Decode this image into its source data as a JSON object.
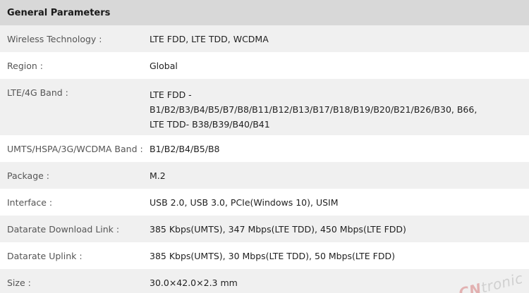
{
  "section_title": "General Parameters",
  "rows": [
    {
      "label": "Wireless Technology :",
      "value": [
        "LTE FDD, LTE TDD, WCDMA"
      ]
    },
    {
      "label": "Region :",
      "value": [
        "Global"
      ]
    },
    {
      "label": "LTE/4G Band :",
      "value": [
        "LTE FDD -",
        "B1/B2/B3/B4/B5/B7/B8/B11/B12/B13/B17/B18/B19/B20/B21/B26/B30, B66,",
        "LTE TDD- B38/B39/B40/B41"
      ]
    },
    {
      "label": "UMTS/HSPA/3G/WCDMA Band :",
      "value": [
        "B1/B2/B4/B5/B8"
      ]
    },
    {
      "label": "Package :",
      "value": [
        "M.2"
      ]
    },
    {
      "label": "Interface :",
      "value": [
        "USB 2.0, USB 3.0, PCIe(Windows 10), USIM"
      ]
    },
    {
      "label": "Datarate Download Link :",
      "value": [
        "385 Kbps(UMTS), 347 Mbps(LTE TDD), 450 Mbps(LTE FDD)"
      ]
    },
    {
      "label": "Datarate Uplink :",
      "value": [
        "385 Kbps(UMTS), 30 Mbps(LTE TDD), 50 Mbps(LTE FDD)"
      ]
    },
    {
      "label": "Size :",
      "value": [
        "30.0×42.0×2.3 mm"
      ]
    }
  ],
  "watermark": {
    "prefix": "CN",
    "suffix": "tronic"
  }
}
